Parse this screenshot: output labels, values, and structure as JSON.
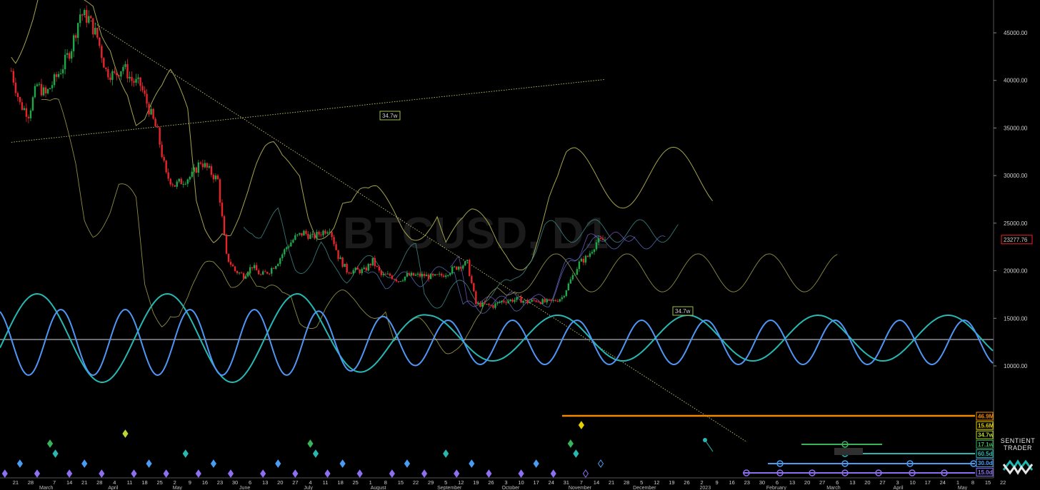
{
  "chart_data": {
    "type": "candlestick",
    "symbol_watermark": "BTCUSD, D1",
    "y_ticks": [
      45000,
      40000,
      35000,
      30000,
      25000,
      20000,
      15000,
      10000
    ],
    "y_tick_labels": [
      "45000.00",
      "40000.00",
      "35000.00",
      "30000.00",
      "25000.00",
      "20000.00",
      "15000.00",
      "10000.00"
    ],
    "ylim": [
      5000,
      48500
    ],
    "current_price": "23277.76",
    "current_price_value": 23277.76,
    "x_ticks": [
      {
        "label": "21",
        "day": -12
      },
      {
        "label": "28",
        "day": -5
      },
      {
        "label": "7",
        "day": 6
      },
      {
        "label": "14",
        "day": 13
      },
      {
        "label": "21",
        "day": 20
      },
      {
        "label": "28",
        "day": 27
      },
      {
        "label": "4",
        "day": 34
      },
      {
        "label": "11",
        "day": 41
      },
      {
        "label": "18",
        "day": 48
      },
      {
        "label": "25",
        "day": 55
      },
      {
        "label": "2",
        "day": 62
      },
      {
        "label": "9",
        "day": 69
      },
      {
        "label": "16",
        "day": 76
      },
      {
        "label": "23",
        "day": 83
      },
      {
        "label": "30",
        "day": 90
      },
      {
        "label": "6",
        "day": 97
      },
      {
        "label": "13",
        "day": 104
      },
      {
        "label": "20",
        "day": 111
      },
      {
        "label": "27",
        "day": 118
      },
      {
        "label": "4",
        "day": 125
      },
      {
        "label": "11",
        "day": 132
      },
      {
        "label": "18",
        "day": 139
      },
      {
        "label": "25",
        "day": 146
      },
      {
        "label": "1",
        "day": 153
      },
      {
        "label": "8",
        "day": 160
      },
      {
        "label": "15",
        "day": 167
      },
      {
        "label": "22",
        "day": 174
      },
      {
        "label": "29",
        "day": 181
      },
      {
        "label": "5",
        "day": 188
      },
      {
        "label": "12",
        "day": 195
      },
      {
        "label": "19",
        "day": 202
      },
      {
        "label": "26",
        "day": 209
      },
      {
        "label": "3",
        "day": 216
      },
      {
        "label": "10",
        "day": 223
      },
      {
        "label": "17",
        "day": 230
      },
      {
        "label": "24",
        "day": 237
      },
      {
        "label": "31",
        "day": 244
      },
      {
        "label": "7",
        "day": 251
      },
      {
        "label": "14",
        "day": 258
      },
      {
        "label": "21",
        "day": 265
      },
      {
        "label": "28",
        "day": 272
      },
      {
        "label": "5",
        "day": 279
      },
      {
        "label": "12",
        "day": 286
      },
      {
        "label": "19",
        "day": 293
      },
      {
        "label": "26",
        "day": 300
      },
      {
        "label": "2",
        "day": 307
      },
      {
        "label": "9",
        "day": 314
      },
      {
        "label": "16",
        "day": 321
      },
      {
        "label": "23",
        "day": 328
      },
      {
        "label": "30",
        "day": 335
      },
      {
        "label": "6",
        "day": 342
      },
      {
        "label": "13",
        "day": 349
      },
      {
        "label": "20",
        "day": 356
      },
      {
        "label": "27",
        "day": 363
      },
      {
        "label": "6",
        "day": 370
      },
      {
        "label": "13",
        "day": 377
      },
      {
        "label": "20",
        "day": 384
      },
      {
        "label": "27",
        "day": 391
      },
      {
        "label": "3",
        "day": 398
      },
      {
        "label": "10",
        "day": 405
      },
      {
        "label": "17",
        "day": 412
      },
      {
        "label": "24",
        "day": 419
      },
      {
        "label": "1",
        "day": 426
      },
      {
        "label": "8",
        "day": 433
      },
      {
        "label": "15",
        "day": 440
      },
      {
        "label": "22",
        "day": 447
      }
    ],
    "month_labels": [
      {
        "label": "March",
        "day": -1
      },
      {
        "label": "April",
        "day": 31
      },
      {
        "label": "May",
        "day": 61
      },
      {
        "label": "June",
        "day": 92
      },
      {
        "label": "July",
        "day": 122
      },
      {
        "label": "August",
        "day": 153
      },
      {
        "label": "September",
        "day": 184
      },
      {
        "label": "October",
        "day": 214
      },
      {
        "label": "November",
        "day": 245
      },
      {
        "label": "December",
        "day": 275
      },
      {
        "label": "2023",
        "day": 306
      },
      {
        "label": "February",
        "day": 337
      },
      {
        "label": "March",
        "day": 365
      },
      {
        "label": "April",
        "day": 396
      },
      {
        "label": "May",
        "day": 426
      }
    ],
    "price_anchors": [
      [
        -14,
        41000
      ],
      [
        -10,
        37500
      ],
      [
        -6,
        36500
      ],
      [
        -2,
        39500
      ],
      [
        2,
        38500
      ],
      [
        6,
        40000
      ],
      [
        10,
        41500
      ],
      [
        14,
        43500
      ],
      [
        18,
        47000
      ],
      [
        22,
        46500
      ],
      [
        26,
        44500
      ],
      [
        30,
        41000
      ],
      [
        34,
        40500
      ],
      [
        38,
        41500
      ],
      [
        42,
        40000
      ],
      [
        46,
        39500
      ],
      [
        50,
        37000
      ],
      [
        54,
        34500
      ],
      [
        58,
        30000
      ],
      [
        62,
        29000
      ],
      [
        66,
        29500
      ],
      [
        70,
        30000
      ],
      [
        74,
        31500
      ],
      [
        78,
        30500
      ],
      [
        82,
        29500
      ],
      [
        86,
        21500
      ],
      [
        90,
        20000
      ],
      [
        94,
        19500
      ],
      [
        98,
        20500
      ],
      [
        102,
        19500
      ],
      [
        106,
        20000
      ],
      [
        110,
        21000
      ],
      [
        114,
        22500
      ],
      [
        118,
        23500
      ],
      [
        122,
        24000
      ],
      [
        126,
        23500
      ],
      [
        130,
        24000
      ],
      [
        134,
        24500
      ],
      [
        138,
        21500
      ],
      [
        142,
        20000
      ],
      [
        146,
        20000
      ],
      [
        150,
        20000
      ],
      [
        154,
        21000
      ],
      [
        158,
        19500
      ],
      [
        162,
        19500
      ],
      [
        166,
        19000
      ],
      [
        170,
        19500
      ],
      [
        174,
        19500
      ],
      [
        178,
        19500
      ],
      [
        182,
        19300
      ],
      [
        186,
        19500
      ],
      [
        190,
        20000
      ],
      [
        194,
        20500
      ],
      [
        198,
        20800
      ],
      [
        202,
        16500
      ],
      [
        206,
        16400
      ],
      [
        210,
        16300
      ],
      [
        214,
        16800
      ],
      [
        218,
        16900
      ],
      [
        222,
        17000
      ],
      [
        226,
        16700
      ],
      [
        230,
        16900
      ],
      [
        234,
        16700
      ],
      [
        238,
        16800
      ],
      [
        242,
        17200
      ],
      [
        246,
        19000
      ],
      [
        250,
        20800
      ],
      [
        254,
        21500
      ],
      [
        258,
        23000
      ],
      [
        262,
        23277.76
      ]
    ],
    "day_x_scale": {
      "d0": 0,
      "x0": 58,
      "d1": 434,
      "x1": 1365
    },
    "series": [
      {
        "name": "34.7w",
        "type": "trend_line",
        "color": "#c8c86a",
        "points": [
          [
            -14,
            33500
          ],
          [
            262,
            40100
          ]
        ]
      },
      {
        "name": "34.7w",
        "type": "trend_line",
        "color": "#c8c86a",
        "points": [
          [
            20,
            46700
          ],
          [
            328,
            2000
          ]
        ]
      }
    ],
    "cycle_badges": [
      {
        "label": "46.9M",
        "color": "#f08a00"
      },
      {
        "label": "15.6M",
        "color": "#e3d100"
      },
      {
        "label": "34.7w",
        "color": "#b7d832"
      },
      {
        "label": "17.1w",
        "color": "#38b35c"
      },
      {
        "label": "60.5d",
        "color": "#2ab7b0"
      },
      {
        "label": "30.0d",
        "color": "#4a9cf2"
      },
      {
        "label": "15.0d",
        "color": "#8d6ff0"
      }
    ],
    "cycle_waves": [
      {
        "name": "60.5d",
        "color": "#26b9b4"
      },
      {
        "name": "30.0d",
        "color": "#4f96f5"
      }
    ],
    "trend_label": "34.7w",
    "logo": {
      "line1": "SENTIENT",
      "line2": "TRADER"
    }
  }
}
